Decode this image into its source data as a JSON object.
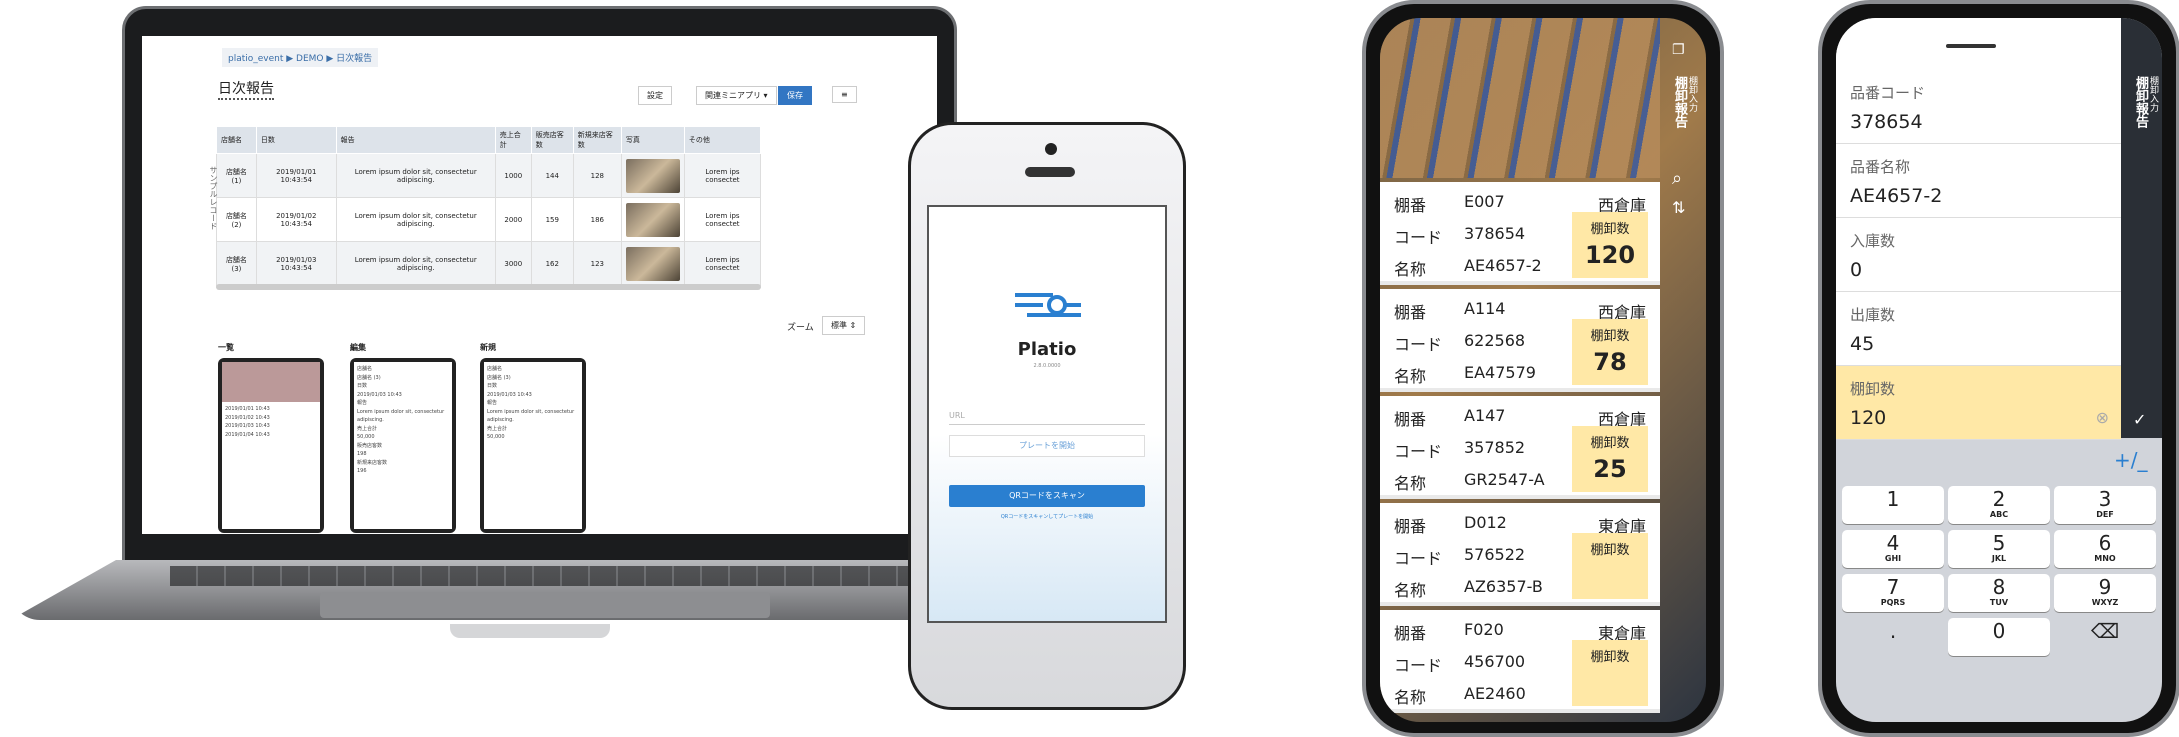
{
  "laptop": {
    "breadcrumb": "platio_event ▶ DEMO ▶ 日次報告",
    "title": "日次報告",
    "buttons": {
      "settings": "設定",
      "related": "関連ミニアプリ ▾",
      "save": "保存",
      "menu": "≡"
    },
    "columns": [
      "店舗名",
      "日数",
      "報告",
      "売上合計",
      "販売店客数",
      "新規来店客数",
      "写真",
      "その他"
    ],
    "rows": [
      [
        "店舗名 (1)",
        "2019/01/01 10:43:54",
        "Lorem ipsum dolor sit, consectetur adipiscing.",
        "1000",
        "144",
        "128",
        "",
        "Lorem ips consectet"
      ],
      [
        "店舗名 (2)",
        "2019/01/02 10:43:54",
        "Lorem ipsum dolor sit, consectetur adipiscing.",
        "2000",
        "159",
        "186",
        "",
        "Lorem ips consectet"
      ],
      [
        "店舗名 (3)",
        "2019/01/03 10:43:54",
        "Lorem ipsum dolor sit, consectetur adipiscing.",
        "3000",
        "162",
        "123",
        "",
        "Lorem ips consectet"
      ]
    ],
    "side_label": "サンプルレコード",
    "zoom_label": "ズーム",
    "zoom_value": "標準 ⇕",
    "mini_titles": [
      "一覧",
      "編集",
      "新規"
    ],
    "mini_list": [
      "2019/01/01 10:43",
      "2019/01/02 10:43",
      "2019/01/03 10:43",
      "2019/01/04 10:43"
    ],
    "mini_edit": [
      "店舗名",
      "店舗名 (3)",
      "日数",
      "2019/01/03 10:43",
      "報告",
      "Lorem ipsum dolor sit, consectetur adipiscing.",
      "売上合計",
      "50,000",
      "販売店客数",
      "198",
      "新規来店客数",
      "196"
    ]
  },
  "iphone": {
    "app_name": "Platio",
    "version": "2.8.0.0000",
    "url_placeholder": "URL",
    "start_button": "プレートを開始",
    "scan_button": "QRコードをスキャン",
    "scan_note": "QRコードをスキャンしてプレートを開始"
  },
  "inventory": {
    "side_title": "棚卸報告",
    "side_sub": "棚卸入力",
    "labels": {
      "shelf": "棚番",
      "code": "コード",
      "name": "名称",
      "count": "棚卸数"
    },
    "cards": [
      {
        "shelf": "E007",
        "warehouse": "西倉庫",
        "code": "378654",
        "name": "AE4657-2",
        "count": "120"
      },
      {
        "shelf": "A114",
        "warehouse": "西倉庫",
        "code": "622568",
        "name": "EA47579",
        "count": "78"
      },
      {
        "shelf": "A147",
        "warehouse": "西倉庫",
        "code": "357852",
        "name": "GR2547-A",
        "count": "25"
      },
      {
        "shelf": "D012",
        "warehouse": "東倉庫",
        "code": "576522",
        "name": "AZ6357-B",
        "count": ""
      },
      {
        "shelf": "F020",
        "warehouse": "東倉庫",
        "code": "456700",
        "name": "AE2460",
        "count": ""
      }
    ]
  },
  "entry": {
    "side_title": "棚卸報告",
    "side_sub": "棚卸入力",
    "fields": [
      {
        "label": "品番コード",
        "value": "378654"
      },
      {
        "label": "品番名称",
        "value": "AE4657-2"
      },
      {
        "label": "入庫数",
        "value": "0"
      },
      {
        "label": "出庫数",
        "value": "45"
      },
      {
        "label": "棚卸数",
        "value": "120"
      }
    ],
    "plusminus": "+/_",
    "keys": [
      [
        "1",
        ""
      ],
      [
        "2",
        "ABC"
      ],
      [
        "3",
        "DEF"
      ],
      [
        "4",
        "GHI"
      ],
      [
        "5",
        "JKL"
      ],
      [
        "6",
        "MNO"
      ],
      [
        "7",
        "PQRS"
      ],
      [
        "8",
        "TUV"
      ],
      [
        "9",
        "WXYZ"
      ],
      [
        ".",
        ""
      ],
      [
        "0",
        ""
      ],
      [
        "⌫",
        ""
      ]
    ]
  }
}
